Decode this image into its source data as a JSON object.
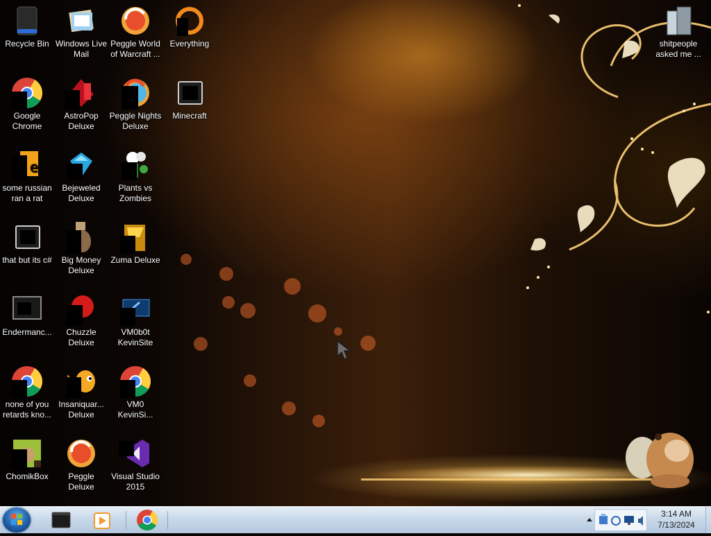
{
  "desktop": {
    "icons": [
      {
        "label": "Recycle Bin",
        "icon": "recycle-bin-icon"
      },
      {
        "label": "Windows Live\nMail",
        "icon": "mail-app-icon"
      },
      {
        "label": "Peggle World\nof Warcraft ...",
        "icon": "peggle-icon"
      },
      {
        "label": "Everything",
        "icon": "everything-search-icon"
      },
      {
        "label": "Google\nChrome",
        "icon": "chrome-icon"
      },
      {
        "label": "AstroPop\nDeluxe",
        "icon": "astropop-icon"
      },
      {
        "label": "Peggle Nights\nDeluxe",
        "icon": "peggle-nights-icon"
      },
      {
        "label": "Minecraft",
        "icon": "shortcut-icon"
      },
      {
        "label": "some russian\nran a rat",
        "icon": "file-icon"
      },
      {
        "label": "Bejeweled\nDeluxe",
        "icon": "bejeweled-icon"
      },
      {
        "label": "Plants vs\nZombies",
        "icon": "plants-vs-zombies-icon"
      },
      {
        "label": "that but its c#",
        "icon": "shortcut-icon"
      },
      {
        "label": "Big Money\nDeluxe",
        "icon": "big-money-icon"
      },
      {
        "label": "Zuma Deluxe",
        "icon": "zuma-icon"
      },
      {
        "label": "Endermanc...",
        "icon": "window-icon"
      },
      {
        "label": "Chuzzle\nDeluxe",
        "icon": "chuzzle-icon"
      },
      {
        "label": "VM0b0t\nKevinSite",
        "icon": "vm-icon"
      },
      {
        "label": "none of you\nretards kno...",
        "icon": "chrome-icon"
      },
      {
        "label": "Insaniquar...\nDeluxe",
        "icon": "insaniquarium-icon"
      },
      {
        "label": "VM0\nKevinSi...",
        "icon": "chrome-icon"
      },
      {
        "label": "ChomikBox",
        "icon": "chomikbox-icon"
      },
      {
        "label": "Peggle Deluxe",
        "icon": "peggle-icon"
      },
      {
        "label": "Visual Studio\n2015",
        "icon": "visual-studio-icon"
      },
      {
        "label": "shitpeople\nasked me ...",
        "icon": "folder-icon"
      }
    ]
  },
  "taskbar": {
    "pinned": [
      {
        "name": "Terminal",
        "icon": "terminal-icon"
      },
      {
        "name": "Media",
        "icon": "media-player-icon"
      },
      {
        "name": "Google Chrome",
        "icon": "chrome-icon"
      }
    ],
    "clock_time": "3:14 AM",
    "clock_date": "7/13/2024"
  },
  "colors": {
    "taskbar": "#c9d9ea",
    "wallpaper_glow": "#e89a28"
  }
}
